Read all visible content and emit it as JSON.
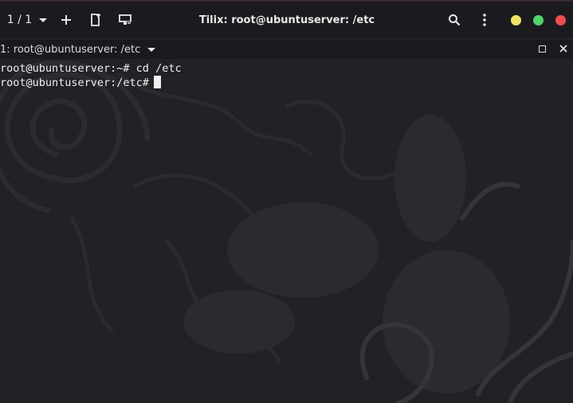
{
  "headerbar": {
    "session_counter": "1 / 1",
    "title": "Tilix: root@ubuntuserver: /etc",
    "icons": {
      "add": "plus-icon",
      "new_session": "new-session-icon",
      "sync_input": "sync-input-icon",
      "search": "search-icon",
      "menu": "kebab-menu-icon"
    },
    "window_controls": {
      "minimize_color": "#f4e266",
      "maximize_color": "#4fd66a",
      "close_color": "#ee4d4d"
    }
  },
  "terminal_header": {
    "title": "1: root@ubuntuserver: /etc"
  },
  "terminal": {
    "lines": [
      "root@ubuntuserver:~# cd /etc",
      "root@ubuntuserver:/etc#"
    ]
  }
}
